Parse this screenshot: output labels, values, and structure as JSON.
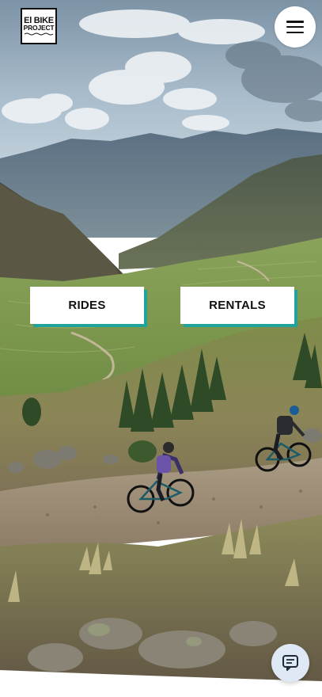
{
  "logo": {
    "line1": "El BIKE",
    "line2": "PROJECT"
  },
  "header": {
    "menu_icon": "hamburger-menu-icon"
  },
  "actions": {
    "rides_label": "RIDES",
    "rentals_label": "RENTALS"
  },
  "chat": {
    "icon": "chat-bubble-icon"
  },
  "colors": {
    "accent": "#1fa39a",
    "button_bg": "#ffffff",
    "chat_bg": "#dfe8f5"
  }
}
